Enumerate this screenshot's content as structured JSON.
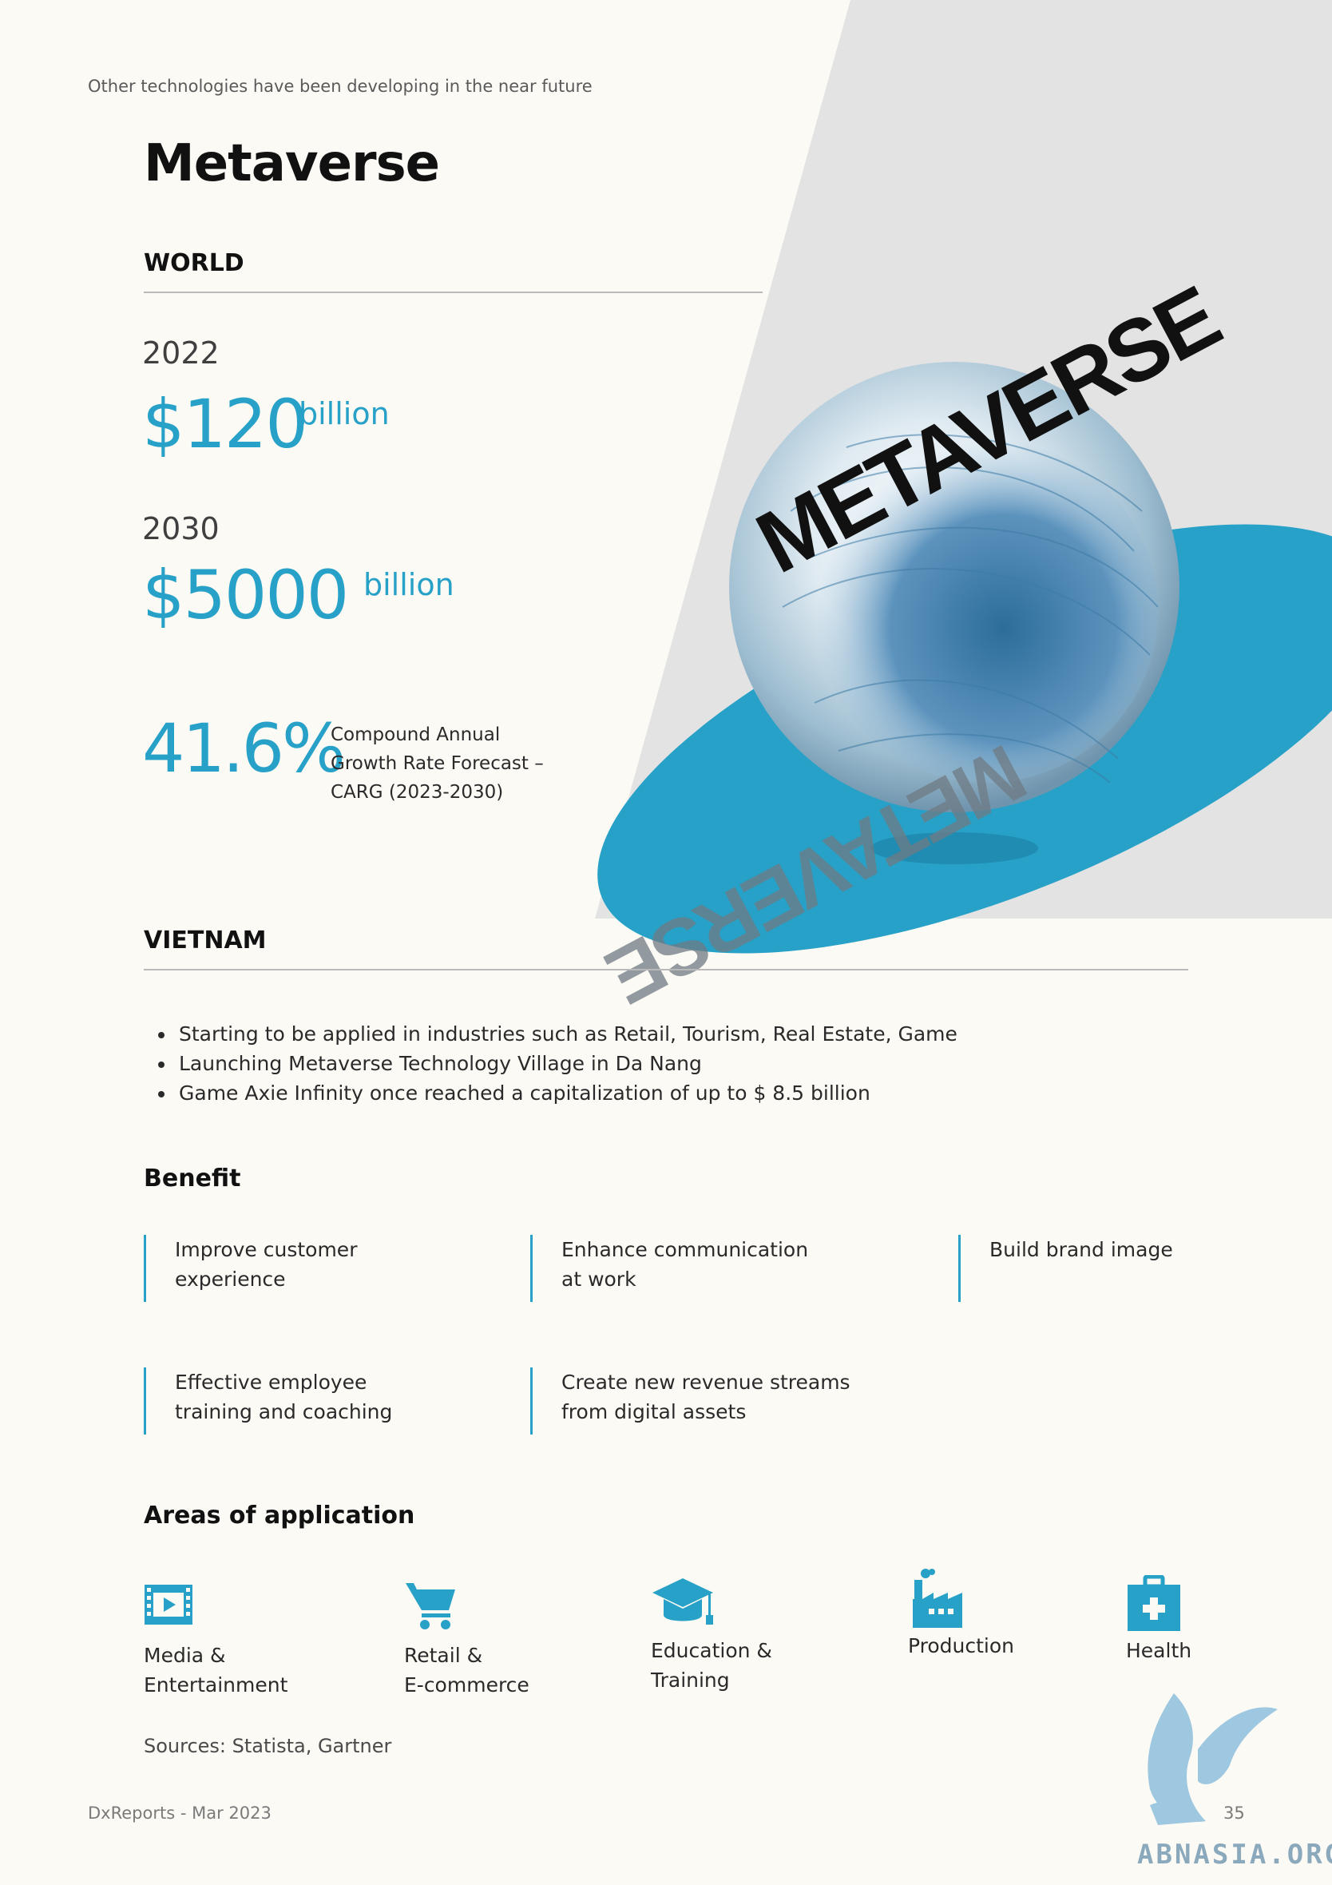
{
  "kicker": "Other technologies have been developing in the near future",
  "title": "Metaverse",
  "world": {
    "heading": "WORLD",
    "stats": [
      {
        "year": "2022",
        "value": "$120",
        "unit": "billion"
      },
      {
        "year": "2030",
        "value": "$5000",
        "unit": "billion"
      }
    ],
    "cagr": {
      "value": "41.6%",
      "description": "Compound Annual Growth Rate Forecast – CARG (2023-2030)"
    }
  },
  "globe": {
    "text_top": "METAVERSE",
    "text_bottom": "METAVERSE"
  },
  "vietnam": {
    "heading": "VIETNAM",
    "bullets": [
      "Starting to be applied in industries such as Retail, Tourism, Real Estate, Game",
      "Launching Metaverse Technology Village in Da Nang",
      "Game Axie Infinity once reached a capitalization of up to $ 8.5 billion"
    ]
  },
  "benefit": {
    "heading": "Benefit",
    "items": [
      {
        "line1": "Improve customer",
        "line2": "experience"
      },
      {
        "line1": "Enhance communication",
        "line2": "at work"
      },
      {
        "line1": "Build brand image",
        "line2": ""
      },
      {
        "line1": "Effective employee",
        "line2": "training and coaching"
      },
      {
        "line1": "Create new revenue streams",
        "line2": "from digital assets"
      }
    ]
  },
  "areas": {
    "heading": "Areas of application",
    "items": [
      {
        "icon": "film-icon",
        "line1": "Media &",
        "line2": "Entertainment"
      },
      {
        "icon": "shopping-cart-icon",
        "line1": "Retail &",
        "line2": "E-commerce"
      },
      {
        "icon": "graduation-cap-icon",
        "line1": "Education &",
        "line2": "Training"
      },
      {
        "icon": "factory-icon",
        "line1": "Production",
        "line2": ""
      },
      {
        "icon": "medical-kit-icon",
        "line1": "Health",
        "line2": ""
      }
    ]
  },
  "sources": "Sources: Statista, Gartner",
  "footer": {
    "left": "DxReports - Mar 2023",
    "page": "35"
  },
  "watermark": "ABNASIA.ORG",
  "colors": {
    "accent": "#27a1c7",
    "background": "#fcfaf5",
    "panel": "#e3e3e3"
  }
}
